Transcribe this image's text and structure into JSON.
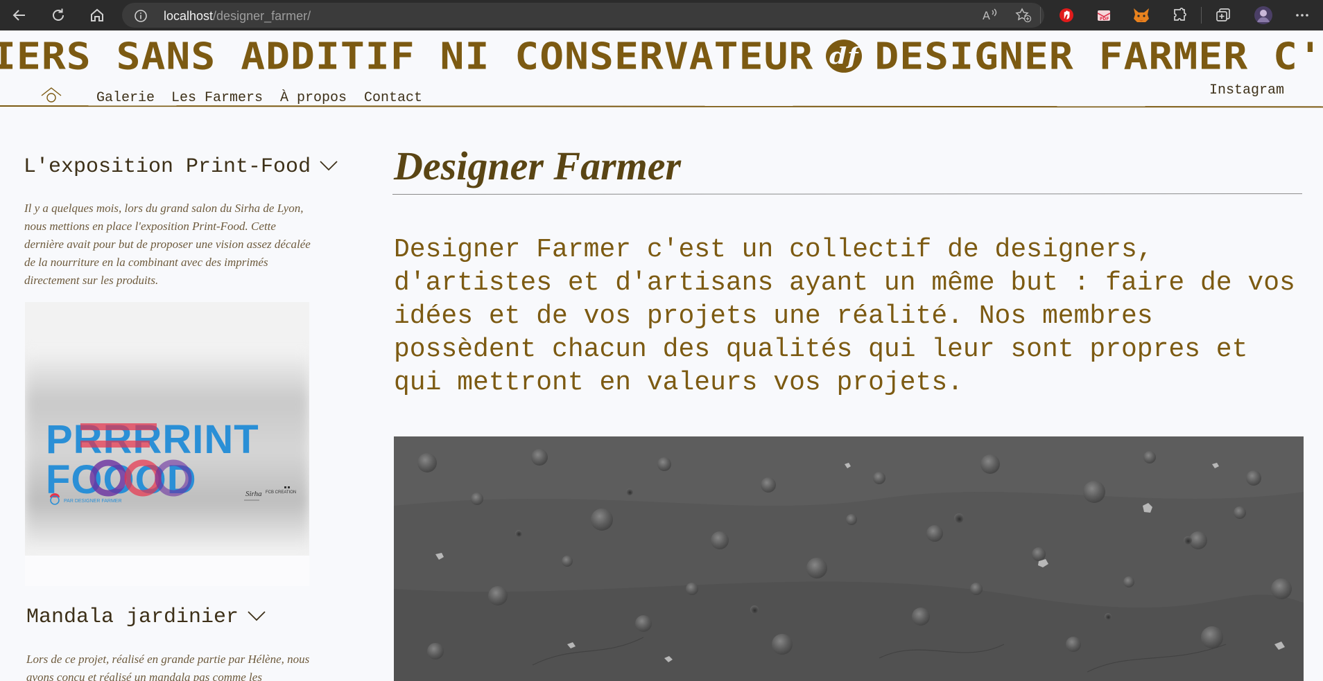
{
  "browser": {
    "url_host": "localhost",
    "url_path": "/designer_farmer/",
    "colors": {
      "frame": "#2b2b2b",
      "urlbar": "#3b3b3b"
    },
    "icons": [
      "back-icon",
      "refresh-icon",
      "home-icon",
      "site-info-icon",
      "read-aloud-icon",
      "favorites-icon",
      "extension-red-icon",
      "extension-pdf-icon",
      "extension-fox-icon",
      "extensions-icon",
      "collections-icon",
      "profile-avatar",
      "more-icon"
    ]
  },
  "site": {
    "marquee_left": "IERS SANS ADDITIF NI CONSERVATEUR",
    "marquee_logo": "df",
    "marquee_right": "DESIGNER FARMER C'EST UN COLLECTIF D'ARTI",
    "nav": [
      "Galerie",
      "Les Farmers",
      "À propos",
      "Contact"
    ],
    "instagram": "Instagram",
    "colors": {
      "accent": "#7c5a12",
      "text": "#3d3018",
      "background": "#f8f9fc"
    }
  },
  "sidebar": {
    "sections": [
      {
        "title": "L'exposition Print-Food",
        "description": "Il y a quelques mois, lors du grand salon du Sirha de Lyon, nous mettions en place l'exposition Print-Food. Cette dernière avait pour but de proposer une vision assez décalée de la nourriture en la combinant avec des imprimés directement sur les produits.",
        "image": {
          "line1": "PRRRRINT",
          "line2": "FOOOD",
          "tagline": "PAR DESIGNER FARMER",
          "partner1": "Sirha",
          "partner2": "FCB CREATION"
        }
      },
      {
        "title": "Mandala jardinier",
        "description": "Lors de ce projet, réalisé en grande partie par Hélène, nous avons conçu et réalisé un mandala pas comme les"
      }
    ]
  },
  "main": {
    "title": "Designer Farmer",
    "intro": "Designer Farmer c'est un collectif de designers, d'artistes et d'artisans ayant un même but : faire de vos idées et de vos projets une réalité. Nos membres possèdent chacun des qualités qui leur sont propres et qui mettront en valeurs vos projets."
  }
}
